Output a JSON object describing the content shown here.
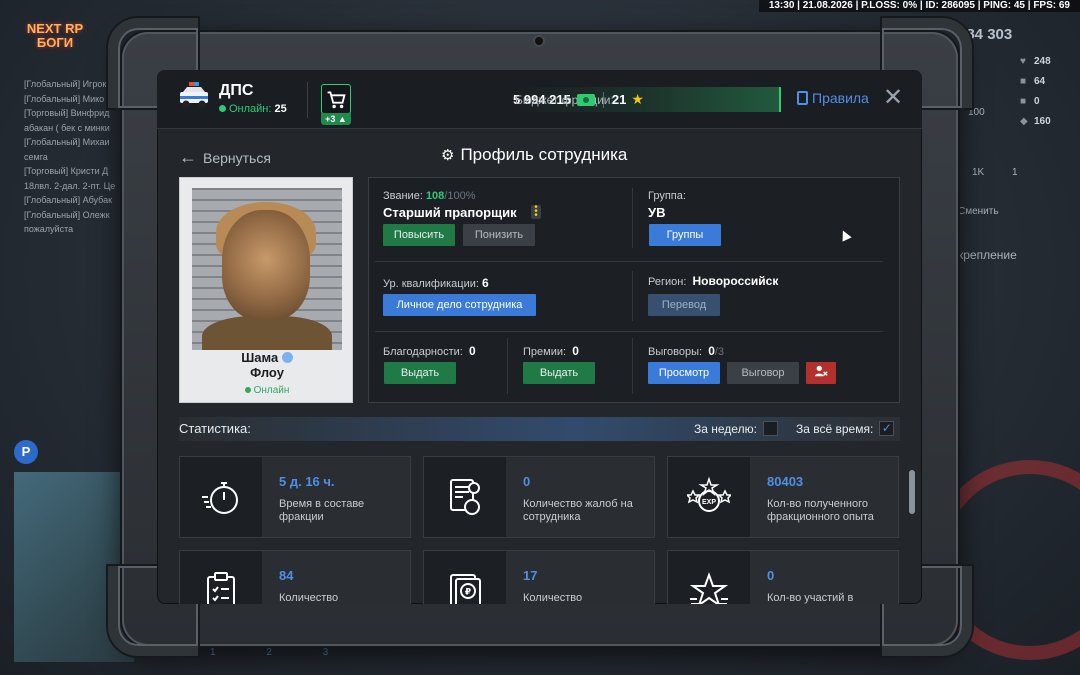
{
  "hud": {
    "topbar": "13:30 | 21.08.2026 | P.LOSS: 0% | ID: 286095 | PING: 45 | FPS: 69",
    "logo_line1": "NEXT RP",
    "logo_line2": "БОГИ",
    "money": "884 303",
    "stats": [
      "248",
      "64",
      "0",
      "160"
    ],
    "stat_100": "100",
    "chat": [
      "[Глобальный] Игрок",
      "[Глобальный] Мико",
      "[Торговый] Винфрид",
      "абакан ( бек с минки",
      "[Глобальный] Михаи",
      "семга",
      "[Торговый] Кристи Д",
      "18лвл. 2-дал. 2-пт. Це",
      "[Глобальный] Абубак",
      "[Глобальный] Олежк",
      "пожалуйста"
    ],
    "side_1k": "1K",
    "side_1": "1",
    "side_change": "Сменить",
    "side_pin": "креплениe",
    "parking": "P",
    "slots": "1 2 3"
  },
  "header": {
    "faction": "ДПС",
    "online_label": "Онлайн:",
    "online_count": "25",
    "cart_badge": "+3",
    "budget_label": "Бюджет фракции:",
    "budget_value": "5 994 215",
    "stars_value": "21",
    "rules_label": "Правила"
  },
  "nav": {
    "back_label": "Вернуться",
    "title": "Профиль сотрудника"
  },
  "profile": {
    "name_first": "Шама",
    "name_last": "Флоу",
    "status": "Онлайн"
  },
  "info": {
    "rank_label": "Звание:",
    "rank_points": "108",
    "rank_max": "/100%",
    "rank_name": "Старший прапорщик",
    "promote_btn": "Повысить",
    "demote_btn": "Понизить",
    "group_label": "Группа:",
    "group_value": "УВ",
    "groups_btn": "Группы",
    "qual_label": "Ур. квалификации:",
    "qual_value": "6",
    "personal_file_btn": "Личное дело сотрудника",
    "region_label": "Регион:",
    "region_value": "Новороссийск",
    "transfer_btn": "Перевод",
    "thanks_label": "Благодарности:",
    "thanks_value": "0",
    "thanks_btn": "Выдать",
    "bonus_label": "Премии:",
    "bonus_value": "0",
    "bonus_btn": "Выдать",
    "reprimand_label": "Выговоры:",
    "reprimand_value": "0",
    "reprimand_max": "/3",
    "view_btn": "Просмотр",
    "reprimand_btn": "Выговор"
  },
  "stats": {
    "title": "Статистика:",
    "week_label": "За неделю:",
    "all_label": "За всё время:",
    "week_checked": false,
    "all_checked": true,
    "cards": [
      {
        "value": "5 д. 16 ч.",
        "desc": "Время в составе фракции",
        "icon": "stopwatch-icon"
      },
      {
        "value": "0",
        "desc": "Количество жалоб на сотрудника",
        "icon": "complaint-icon"
      },
      {
        "value": "80403",
        "desc": "Кол-во полученного фракционного опыта",
        "icon": "exp-icon"
      },
      {
        "value": "84",
        "desc": "Количество",
        "icon": "clipboard-icon"
      },
      {
        "value": "17",
        "desc": "Количество",
        "icon": "ruble-document-icon"
      },
      {
        "value": "0",
        "desc": "Кол-во участий в",
        "icon": "star-icon"
      }
    ]
  },
  "colors": {
    "accent_blue": "#4f8fe6",
    "accent_green": "#2ecc71",
    "danger_red": "#b3302c"
  }
}
